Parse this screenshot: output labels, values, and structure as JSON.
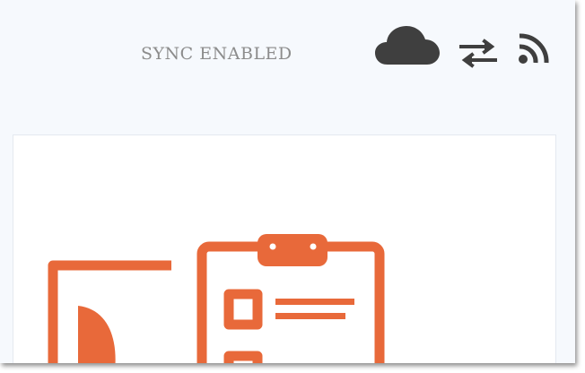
{
  "header": {
    "status_label": "SYNC ENABLED",
    "icons": [
      "cloud-icon",
      "transfer-arrows-icon",
      "rss-feed-icon"
    ]
  },
  "colors": {
    "background": "#f6f9fd",
    "status_text": "#8c8c8c",
    "icon_dark": "#3f3f3f",
    "illustration_orange": "#e8693a"
  },
  "illustration": {
    "subject": "clipboard-with-checklist"
  }
}
